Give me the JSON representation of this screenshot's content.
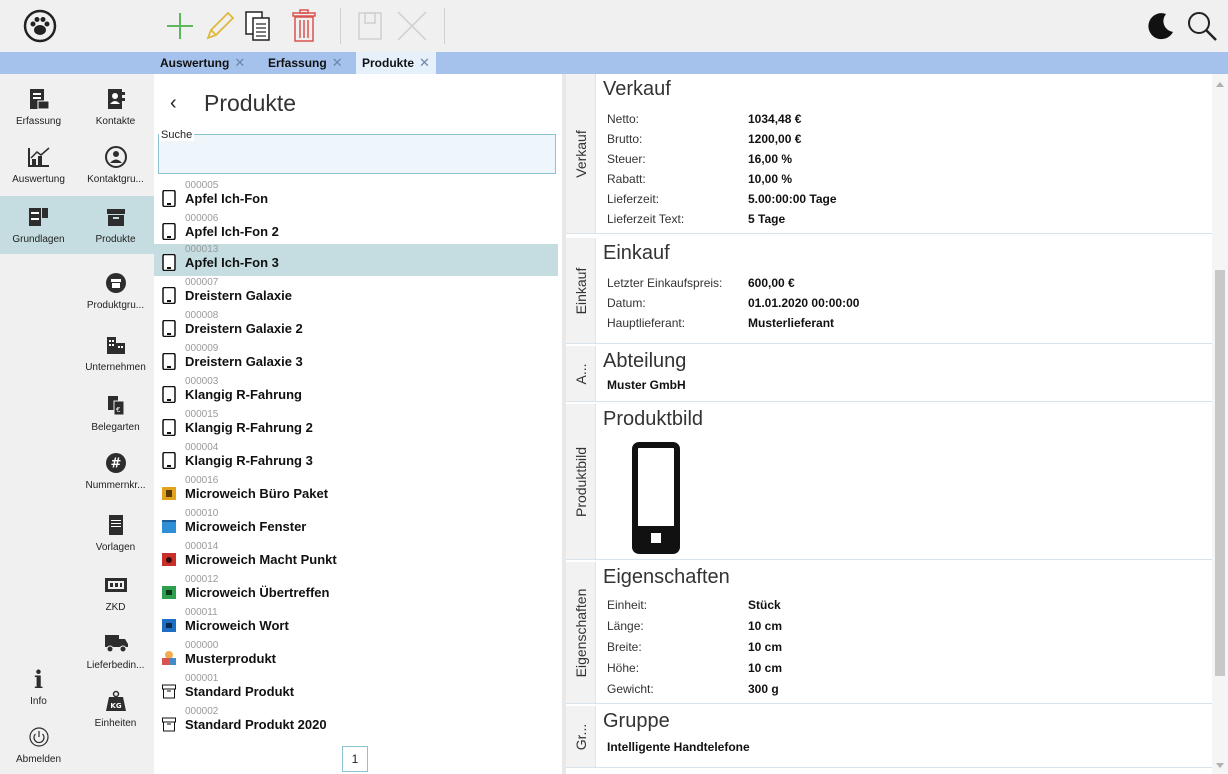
{
  "toolbar": {
    "icons": [
      "paw-icon",
      "plus-icon",
      "pencil-icon",
      "copy-icon",
      "trash-icon",
      "document-icon",
      "close-icon",
      "moon-icon",
      "search-icon"
    ]
  },
  "tabs": [
    {
      "label": "Auswertung",
      "active": false
    },
    {
      "label": "Erfassung",
      "active": false
    },
    {
      "label": "Produkte",
      "active": true
    }
  ],
  "sidenav": {
    "left_column": [
      {
        "label": "Erfassung",
        "icon": "clipboard-icon"
      },
      {
        "label": "Auswertung",
        "icon": "chart-icon"
      },
      {
        "label": "Grundlagen",
        "icon": "database-icon",
        "selected": true
      },
      {
        "label": "Info",
        "icon": "info-icon"
      },
      {
        "label": "Abmelden",
        "icon": "power-icon"
      }
    ],
    "right_column": [
      {
        "label": "Kontakte",
        "icon": "contact-book-icon"
      },
      {
        "label": "Kontaktgru...",
        "icon": "contact-group-icon"
      },
      {
        "label": "Produkte",
        "icon": "product-box-icon"
      },
      {
        "label": "Produktgru...",
        "icon": "product-group-icon"
      },
      {
        "label": "Unternehmen",
        "icon": "building-icon"
      },
      {
        "label": "Belegarten",
        "icon": "document-types-icon"
      },
      {
        "label": "Nummernkr...",
        "icon": "hash-icon"
      },
      {
        "label": "Vorlagen",
        "icon": "template-icon"
      },
      {
        "label": "ZKD",
        "icon": "id-card-icon"
      },
      {
        "label": "Lieferbedin...",
        "icon": "truck-icon"
      },
      {
        "label": "Einheiten",
        "icon": "weight-icon"
      }
    ]
  },
  "list": {
    "title": "Produkte",
    "search_label": "Suche",
    "search_value": "",
    "page": "1",
    "items": [
      {
        "code": "000005",
        "name": "Apfel Ich-Fon",
        "icon": "phone-icon"
      },
      {
        "code": "000006",
        "name": "Apfel Ich-Fon 2",
        "icon": "phone-icon"
      },
      {
        "code": "000013",
        "name": "Apfel Ich-Fon 3",
        "icon": "phone-icon",
        "selected": true
      },
      {
        "code": "000007",
        "name": "Dreistern Galaxie",
        "icon": "phone-icon"
      },
      {
        "code": "000008",
        "name": "Dreistern Galaxie 2",
        "icon": "phone-icon"
      },
      {
        "code": "000009",
        "name": "Dreistern Galaxie 3",
        "icon": "phone-icon"
      },
      {
        "code": "000003",
        "name": "Klangig R-Fahrung",
        "icon": "phone-icon"
      },
      {
        "code": "000015",
        "name": "Klangig R-Fahrung 2",
        "icon": "phone-icon"
      },
      {
        "code": "000004",
        "name": "Klangig R-Fahrung 3",
        "icon": "phone-icon"
      },
      {
        "code": "000016",
        "name": "Microweich Büro Paket",
        "icon": "office-package-icon"
      },
      {
        "code": "000010",
        "name": "Microweich Fenster",
        "icon": "window-app-icon"
      },
      {
        "code": "000014",
        "name": "Microweich Macht Punkt",
        "icon": "presentation-app-icon"
      },
      {
        "code": "000012",
        "name": "Microweich Übertreffen",
        "icon": "spreadsheet-app-icon"
      },
      {
        "code": "000011",
        "name": "Microweich Wort",
        "icon": "word-app-icon"
      },
      {
        "code": "000000",
        "name": "Musterprodukt",
        "icon": "shapes-icon"
      },
      {
        "code": "000001",
        "name": "Standard Produkt",
        "icon": "box-icon"
      },
      {
        "code": "000002",
        "name": "Standard Produkt 2020",
        "icon": "box-icon"
      }
    ]
  },
  "detail": {
    "verkauf": {
      "tab": "Verkauf",
      "title": "Verkauf",
      "fields": [
        {
          "label": "Netto:",
          "value": "1034,48 €"
        },
        {
          "label": "Brutto:",
          "value": "1200,00 €"
        },
        {
          "label": "Steuer:",
          "value": "16,00 %"
        },
        {
          "label": "Rabatt:",
          "value": "10,00 %"
        },
        {
          "label": "Lieferzeit:",
          "value": "5.00:00:00 Tage"
        },
        {
          "label": "Lieferzeit Text:",
          "value": "5 Tage"
        }
      ]
    },
    "einkauf": {
      "tab": "Einkauf",
      "title": "Einkauf",
      "fields": [
        {
          "label": "Letzter Einkaufspreis:",
          "value": "600,00 €"
        },
        {
          "label": "Datum:",
          "value": "01.01.2020 00:00:00"
        },
        {
          "label": "Hauptlieferant:",
          "value": "Musterlieferant"
        }
      ]
    },
    "abteilung": {
      "tab": "A...",
      "title": "Abteilung",
      "value": "Muster GmbH"
    },
    "produktbild": {
      "tab": "Produktbild",
      "title": "Produktbild",
      "icon": "phone-icon"
    },
    "eigenschaften": {
      "tab": "Eigenschaften",
      "title": "Eigenschaften",
      "fields": [
        {
          "label": "Einheit:",
          "value": "Stück"
        },
        {
          "label": "Länge:",
          "value": "10 cm"
        },
        {
          "label": "Breite:",
          "value": "10 cm"
        },
        {
          "label": "Höhe:",
          "value": "10 cm"
        },
        {
          "label": "Gewicht:",
          "value": "300 g"
        }
      ]
    },
    "gruppe": {
      "tab": "Gr...",
      "title": "Gruppe",
      "value": "Intelligente Handtelefone"
    }
  },
  "colors": {
    "accent": "#5cb85c",
    "tabstrip": "#a4c2ec",
    "selection": "#c5dde0",
    "delete": "#d9534f",
    "pencil": "#e8c94a"
  }
}
